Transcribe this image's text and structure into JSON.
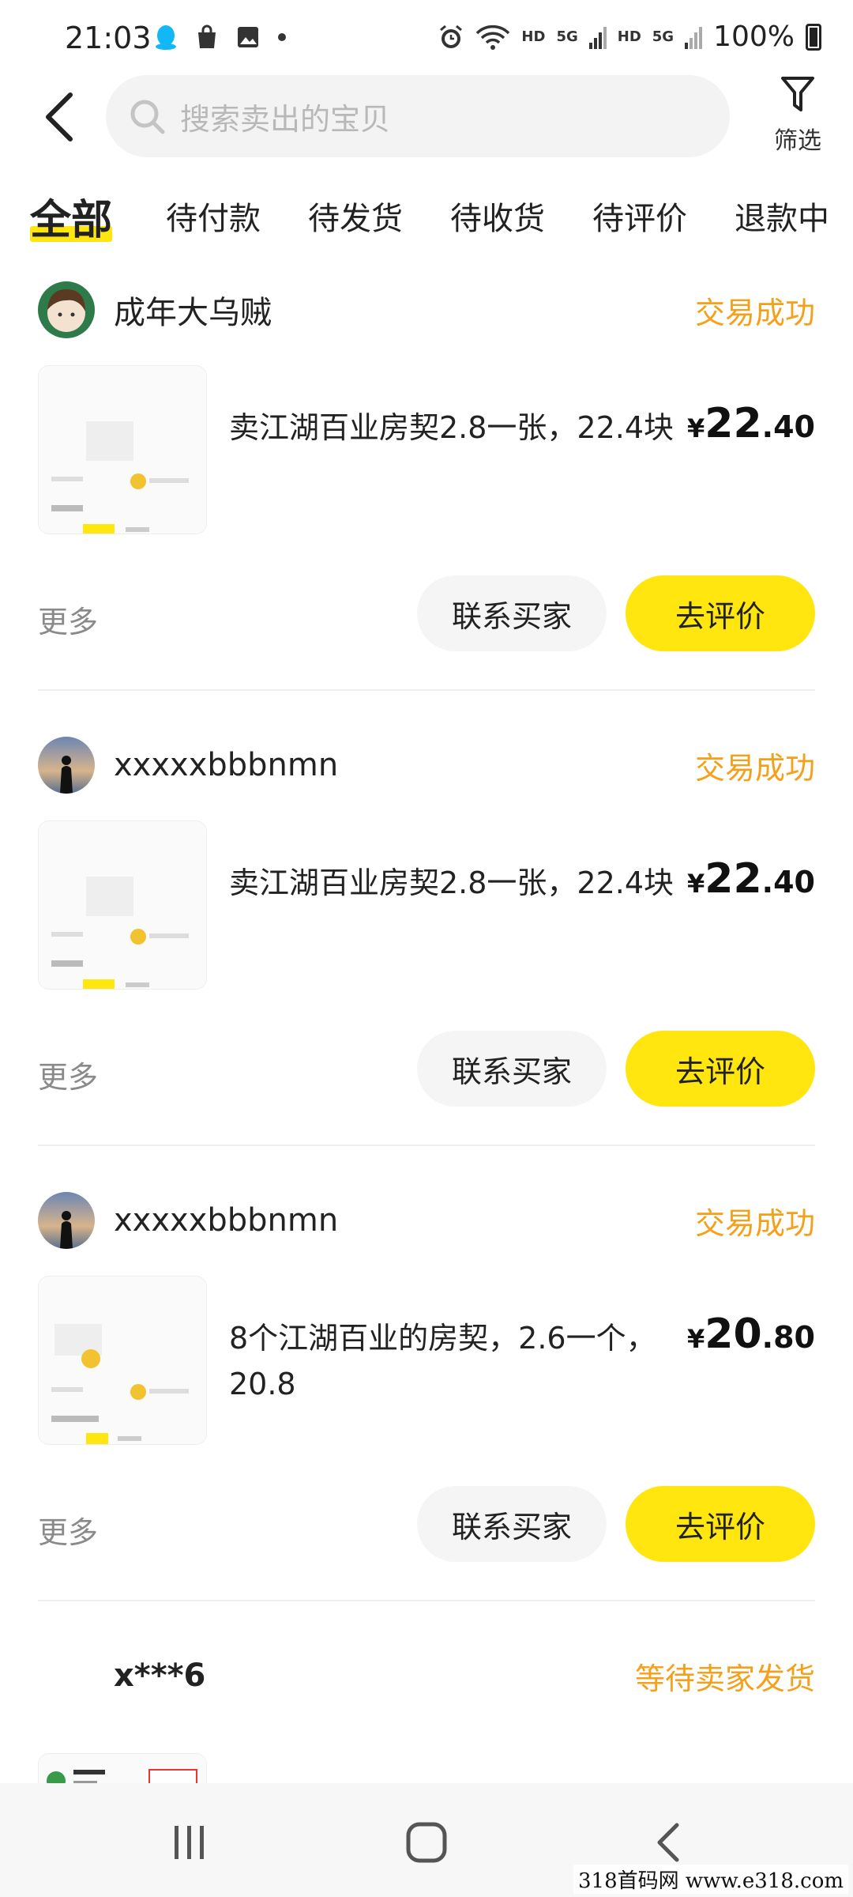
{
  "status_bar": {
    "time": "21:03",
    "network_label_1": "HD",
    "network_label_2": "5G",
    "network_label_3": "HD",
    "network_label_4": "5G",
    "battery": "100%"
  },
  "header": {
    "search_placeholder": "搜索卖出的宝贝",
    "filter_label": "筛选"
  },
  "tabs": [
    {
      "label": "全部",
      "active": true
    },
    {
      "label": "待付款",
      "active": false
    },
    {
      "label": "待发货",
      "active": false
    },
    {
      "label": "待收货",
      "active": false
    },
    {
      "label": "待评价",
      "active": false
    },
    {
      "label": "退款中",
      "active": false
    }
  ],
  "orders": [
    {
      "buyer": "成年大乌贼",
      "status": "交易成功",
      "title": "卖江湖百业房契2.8一张，22.4块",
      "price_currency": "¥",
      "price_int": "22",
      "price_dec": ".40",
      "more": "更多",
      "contact": "联系买家",
      "review": "去评价"
    },
    {
      "buyer": "xxxxxbbbnmn",
      "status": "交易成功",
      "title": "卖江湖百业房契2.8一张，22.4块",
      "price_currency": "¥",
      "price_int": "22",
      "price_dec": ".40",
      "more": "更多",
      "contact": "联系买家",
      "review": "去评价"
    },
    {
      "buyer": "xxxxxbbbnmn",
      "status": "交易成功",
      "title": "8个江湖百业的房契，2.6一个，20.8",
      "price_currency": "¥",
      "price_int": "20",
      "price_dec": ".80",
      "more": "更多",
      "contact": "联系买家",
      "review": "去评价"
    },
    {
      "buyer": "x***6",
      "status": "等待卖家发货"
    }
  ],
  "watermark": "318首码网  www.e318.com",
  "colors": {
    "accent_yellow": "#ffe60f",
    "status_orange": "#f5a01b"
  }
}
